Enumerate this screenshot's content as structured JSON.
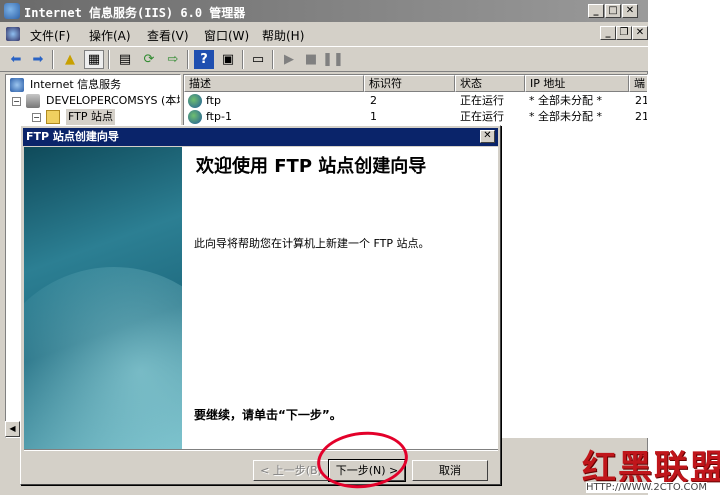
{
  "window": {
    "title": "Internet 信息服务(IIS) 6.0 管理器",
    "minimize": "_",
    "maximize": "□",
    "close": "✕"
  },
  "menu": {
    "items": [
      "文件(F)",
      "操作(A)",
      "查看(V)",
      "窗口(W)",
      "帮助(H)"
    ],
    "mdi_min": "_",
    "mdi_restore": "❐",
    "mdi_close": "✕"
  },
  "toolbar": {
    "icons": [
      "back-icon",
      "forward-icon",
      "up-icon",
      "show-tree-icon",
      "properties-icon",
      "refresh-icon",
      "export-icon",
      "help-icon",
      "view-icon",
      "computer-icon",
      "play-icon",
      "stop-icon",
      "pause-icon"
    ]
  },
  "tree": {
    "root": "Internet 信息服务",
    "server": "DEVELOPERCOMSYS (本地计",
    "ftp_sites": "FTP 站点"
  },
  "list": {
    "columns": [
      "描述",
      "标识符",
      "状态",
      "IP 地址",
      "端"
    ],
    "rows": [
      {
        "desc": "ftp",
        "id": "2",
        "state": "正在运行",
        "ip": "* 全部未分配 *",
        "port": "21"
      },
      {
        "desc": "ftp-1",
        "id": "1",
        "state": "正在运行",
        "ip": "* 全部未分配 *",
        "port": "21"
      }
    ]
  },
  "wizard": {
    "title": "FTP 站点创建向导",
    "close": "✕",
    "heading": "欢迎使用 FTP 站点创建向导",
    "description": "此向导将帮助您在计算机上新建一个 FTP 站点。",
    "continue_hint": "要继续，请单击“下一步”。",
    "back_label": "< 上一步(B)",
    "next_label": "下一步(N) >",
    "cancel_label": "取消"
  },
  "watermark": {
    "logo": "红黑联盟",
    "url": "HTTP://WWW.2CTO.COM"
  },
  "colors": {
    "annotation": "#e3002a",
    "wizard_titlebar": "#0a246a",
    "face": "#d4d0c8"
  }
}
